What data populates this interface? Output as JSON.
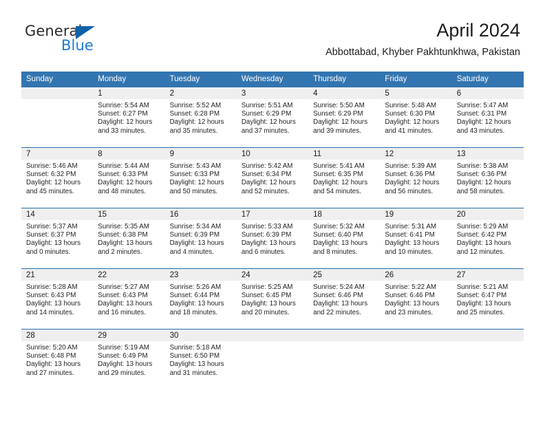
{
  "brand": {
    "name_part1": "General",
    "name_part2": "Blue",
    "logo_icon": "triangle-logo-icon",
    "accent_color": "#0f62a8",
    "blue_text_color": "#1b7ad4"
  },
  "header": {
    "title": "April 2024",
    "subtitle": "Abbottabad, Khyber Pakhtunkhwa, Pakistan"
  },
  "theme": {
    "header_bg": "#3375b0",
    "header_text": "#ffffff",
    "row_divider": "#2a6ead",
    "daynum_band_bg": "#efefef",
    "cell_bg": "#ffffff"
  },
  "calendar": {
    "weekday_headers": [
      "Sunday",
      "Monday",
      "Tuesday",
      "Wednesday",
      "Thursday",
      "Friday",
      "Saturday"
    ],
    "weeks": [
      [
        {
          "day": "",
          "blank": true
        },
        {
          "day": "1",
          "sunrise": "Sunrise: 5:54 AM",
          "sunset": "Sunset: 6:27 PM",
          "daylight": "Daylight: 12 hours and 33 minutes."
        },
        {
          "day": "2",
          "sunrise": "Sunrise: 5:52 AM",
          "sunset": "Sunset: 6:28 PM",
          "daylight": "Daylight: 12 hours and 35 minutes."
        },
        {
          "day": "3",
          "sunrise": "Sunrise: 5:51 AM",
          "sunset": "Sunset: 6:29 PM",
          "daylight": "Daylight: 12 hours and 37 minutes."
        },
        {
          "day": "4",
          "sunrise": "Sunrise: 5:50 AM",
          "sunset": "Sunset: 6:29 PM",
          "daylight": "Daylight: 12 hours and 39 minutes."
        },
        {
          "day": "5",
          "sunrise": "Sunrise: 5:48 AM",
          "sunset": "Sunset: 6:30 PM",
          "daylight": "Daylight: 12 hours and 41 minutes."
        },
        {
          "day": "6",
          "sunrise": "Sunrise: 5:47 AM",
          "sunset": "Sunset: 6:31 PM",
          "daylight": "Daylight: 12 hours and 43 minutes."
        }
      ],
      [
        {
          "day": "7",
          "sunrise": "Sunrise: 5:46 AM",
          "sunset": "Sunset: 6:32 PM",
          "daylight": "Daylight: 12 hours and 45 minutes."
        },
        {
          "day": "8",
          "sunrise": "Sunrise: 5:44 AM",
          "sunset": "Sunset: 6:33 PM",
          "daylight": "Daylight: 12 hours and 48 minutes."
        },
        {
          "day": "9",
          "sunrise": "Sunrise: 5:43 AM",
          "sunset": "Sunset: 6:33 PM",
          "daylight": "Daylight: 12 hours and 50 minutes."
        },
        {
          "day": "10",
          "sunrise": "Sunrise: 5:42 AM",
          "sunset": "Sunset: 6:34 PM",
          "daylight": "Daylight: 12 hours and 52 minutes."
        },
        {
          "day": "11",
          "sunrise": "Sunrise: 5:41 AM",
          "sunset": "Sunset: 6:35 PM",
          "daylight": "Daylight: 12 hours and 54 minutes."
        },
        {
          "day": "12",
          "sunrise": "Sunrise: 5:39 AM",
          "sunset": "Sunset: 6:36 PM",
          "daylight": "Daylight: 12 hours and 56 minutes."
        },
        {
          "day": "13",
          "sunrise": "Sunrise: 5:38 AM",
          "sunset": "Sunset: 6:36 PM",
          "daylight": "Daylight: 12 hours and 58 minutes."
        }
      ],
      [
        {
          "day": "14",
          "sunrise": "Sunrise: 5:37 AM",
          "sunset": "Sunset: 6:37 PM",
          "daylight": "Daylight: 13 hours and 0 minutes."
        },
        {
          "day": "15",
          "sunrise": "Sunrise: 5:35 AM",
          "sunset": "Sunset: 6:38 PM",
          "daylight": "Daylight: 13 hours and 2 minutes."
        },
        {
          "day": "16",
          "sunrise": "Sunrise: 5:34 AM",
          "sunset": "Sunset: 6:39 PM",
          "daylight": "Daylight: 13 hours and 4 minutes."
        },
        {
          "day": "17",
          "sunrise": "Sunrise: 5:33 AM",
          "sunset": "Sunset: 6:39 PM",
          "daylight": "Daylight: 13 hours and 6 minutes."
        },
        {
          "day": "18",
          "sunrise": "Sunrise: 5:32 AM",
          "sunset": "Sunset: 6:40 PM",
          "daylight": "Daylight: 13 hours and 8 minutes."
        },
        {
          "day": "19",
          "sunrise": "Sunrise: 5:31 AM",
          "sunset": "Sunset: 6:41 PM",
          "daylight": "Daylight: 13 hours and 10 minutes."
        },
        {
          "day": "20",
          "sunrise": "Sunrise: 5:29 AM",
          "sunset": "Sunset: 6:42 PM",
          "daylight": "Daylight: 13 hours and 12 minutes."
        }
      ],
      [
        {
          "day": "21",
          "sunrise": "Sunrise: 5:28 AM",
          "sunset": "Sunset: 6:43 PM",
          "daylight": "Daylight: 13 hours and 14 minutes."
        },
        {
          "day": "22",
          "sunrise": "Sunrise: 5:27 AM",
          "sunset": "Sunset: 6:43 PM",
          "daylight": "Daylight: 13 hours and 16 minutes."
        },
        {
          "day": "23",
          "sunrise": "Sunrise: 5:26 AM",
          "sunset": "Sunset: 6:44 PM",
          "daylight": "Daylight: 13 hours and 18 minutes."
        },
        {
          "day": "24",
          "sunrise": "Sunrise: 5:25 AM",
          "sunset": "Sunset: 6:45 PM",
          "daylight": "Daylight: 13 hours and 20 minutes."
        },
        {
          "day": "25",
          "sunrise": "Sunrise: 5:24 AM",
          "sunset": "Sunset: 6:46 PM",
          "daylight": "Daylight: 13 hours and 22 minutes."
        },
        {
          "day": "26",
          "sunrise": "Sunrise: 5:22 AM",
          "sunset": "Sunset: 6:46 PM",
          "daylight": "Daylight: 13 hours and 23 minutes."
        },
        {
          "day": "27",
          "sunrise": "Sunrise: 5:21 AM",
          "sunset": "Sunset: 6:47 PM",
          "daylight": "Daylight: 13 hours and 25 minutes."
        }
      ],
      [
        {
          "day": "28",
          "sunrise": "Sunrise: 5:20 AM",
          "sunset": "Sunset: 6:48 PM",
          "daylight": "Daylight: 13 hours and 27 minutes."
        },
        {
          "day": "29",
          "sunrise": "Sunrise: 5:19 AM",
          "sunset": "Sunset: 6:49 PM",
          "daylight": "Daylight: 13 hours and 29 minutes."
        },
        {
          "day": "30",
          "sunrise": "Sunrise: 5:18 AM",
          "sunset": "Sunset: 6:50 PM",
          "daylight": "Daylight: 13 hours and 31 minutes."
        },
        {
          "day": "",
          "blank": true
        },
        {
          "day": "",
          "blank": true
        },
        {
          "day": "",
          "blank": true
        },
        {
          "day": "",
          "blank": true
        }
      ]
    ]
  }
}
